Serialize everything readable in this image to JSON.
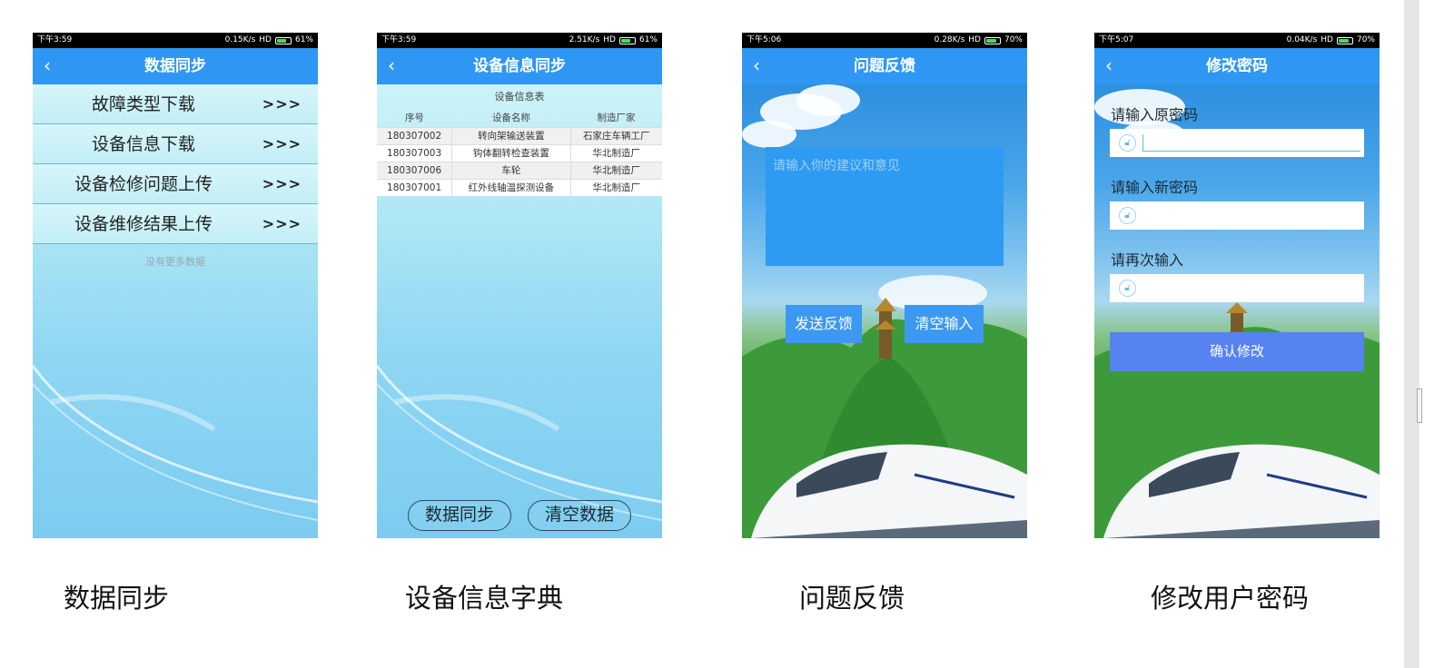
{
  "colors": {
    "titlebar": "#2f97f3",
    "feedback_box": "#2e9af2",
    "confirm_button": "#5683f0"
  },
  "screens": [
    {
      "status": {
        "time": "下午3:59",
        "speed": "0.15K/s",
        "net": "HD",
        "battery": "61%",
        "battery_level": 0.61
      },
      "title": "数据同步",
      "menu": [
        {
          "label": "故障类型下载",
          "arrow": ">>>"
        },
        {
          "label": "设备信息下载",
          "arrow": ">>>"
        },
        {
          "label": "设备检修问题上传",
          "arrow": ">>>"
        },
        {
          "label": "设备维修结果上传",
          "arrow": ">>>"
        }
      ],
      "footer": "没有更多数据"
    },
    {
      "status": {
        "time": "下午3:59",
        "speed": "2.51K/s",
        "net": "HD",
        "battery": "61%",
        "battery_level": 0.61
      },
      "title": "设备信息同步",
      "table_title": "设备信息表",
      "columns": [
        "序号",
        "设备名称",
        "制造厂家"
      ],
      "rows": [
        [
          "180307002",
          "转向架输送装置",
          "石家庄车辆工厂"
        ],
        [
          "180307003",
          "钩体翻转检查装置",
          "华北制造厂"
        ],
        [
          "180307006",
          "车轮",
          "华北制造厂"
        ],
        [
          "180307001",
          "红外线轴温探测设备",
          "华北制造厂"
        ]
      ],
      "buttons": [
        "数据同步",
        "清空数据"
      ]
    },
    {
      "status": {
        "time": "下午5:06",
        "speed": "0.28K/s",
        "net": "HD",
        "battery": "70%",
        "battery_level": 0.7
      },
      "title": "问题反馈",
      "placeholder": "请输入你的建议和意见",
      "buttons": [
        "发送反馈",
        "清空输入"
      ]
    },
    {
      "status": {
        "time": "下午5:07",
        "speed": "0.04K/s",
        "net": "HD",
        "battery": "70%",
        "battery_level": 0.7
      },
      "title": "修改密码",
      "labels": [
        "请输入原密码",
        "请输入新密码",
        "请再次输入"
      ],
      "confirm": "确认修改"
    }
  ],
  "captions": [
    "数据同步",
    "设备信息字典",
    "问题反馈",
    "修改用户密码"
  ],
  "icons": {
    "back": "chevron-left-icon",
    "lock": "lock-icon",
    "battery": "battery-icon"
  }
}
